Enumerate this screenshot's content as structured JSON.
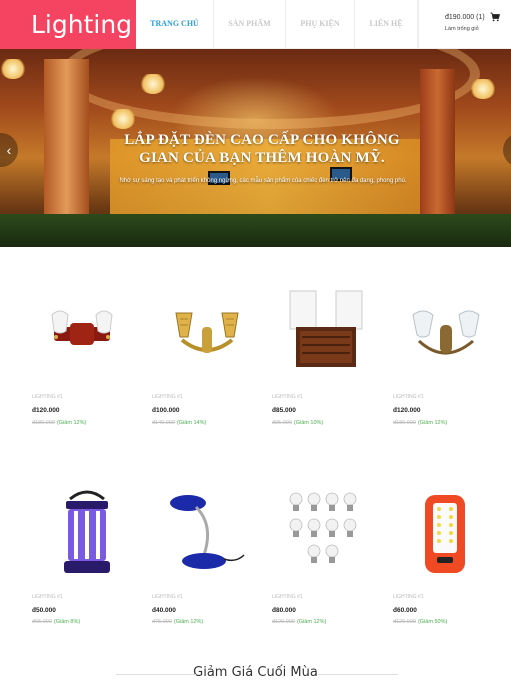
{
  "brand": {
    "logo_text": "Lighting",
    "color": "#f44462"
  },
  "nav": {
    "items": [
      {
        "label": "TRANG CHỦ",
        "active": true
      },
      {
        "label": "SẢN PHẨM",
        "active": false
      },
      {
        "label": "PHỤ KIỆN",
        "active": false
      },
      {
        "label": "LIÊN HỆ",
        "active": false
      }
    ]
  },
  "cart": {
    "total": "đ190.000 (1)",
    "empty_label": "Làm trống giỏ",
    "icon": "shopping-cart-icon"
  },
  "banner": {
    "title": "LẮP ĐẶT ĐÈN CAO CẤP CHO KHÔNG GIAN CỦA BẠN THÊM HOÀN MỸ.",
    "subtitle": "Nhờ sự sáng tạo và phát triển không ngừng, các mẫu sản phẩm của chiếc đèn trở nên đa dạng, phong phú.",
    "prev_icon": "chevron-left-icon",
    "next_icon": "chevron-right-icon"
  },
  "products": [
    {
      "category": "LIGHTING #1",
      "price": "đ120.000",
      "old_price": "đ180.000",
      "discount": "(Giảm 12%)",
      "image": "wall-lamp-red"
    },
    {
      "category": "LIGHTING #1",
      "price": "đ100.000",
      "old_price": "đ140.000",
      "discount": "(Giảm 14%)",
      "image": "wall-lamp-gold"
    },
    {
      "category": "LIGHTING #1",
      "price": "đ85.000",
      "old_price": "đ95.000",
      "discount": "(Giảm 10%)",
      "image": "wall-lamp-wood"
    },
    {
      "category": "LIGHTING #1",
      "price": "đ120.000",
      "old_price": "đ180.000",
      "discount": "(Giảm 12%)",
      "image": "wall-lamp-brass"
    },
    {
      "category": "LIGHTING #1",
      "price": "đ50.000",
      "old_price": "đ65.000",
      "discount": "(Giảm 8%)",
      "image": "camping-lantern"
    },
    {
      "category": "LIGHTING #1",
      "price": "đ40.000",
      "old_price": "đ75.000",
      "discount": "(Giảm 12%)",
      "image": "desk-lamp-blue"
    },
    {
      "category": "LIGHTING #1",
      "price": "đ80.000",
      "old_price": "đ120.000",
      "discount": "(Giảm 12%)",
      "image": "led-bulbs"
    },
    {
      "category": "LIGHTING #1",
      "price": "đ60.000",
      "old_price": "đ120.000",
      "discount": "(Giảm 50%)",
      "image": "rechargeable-lamp"
    }
  ],
  "section": {
    "title": "Giảm Giá Cuối Mùa"
  },
  "colors": {
    "accent": "#2a9fd6",
    "discount": "#4caf50"
  }
}
